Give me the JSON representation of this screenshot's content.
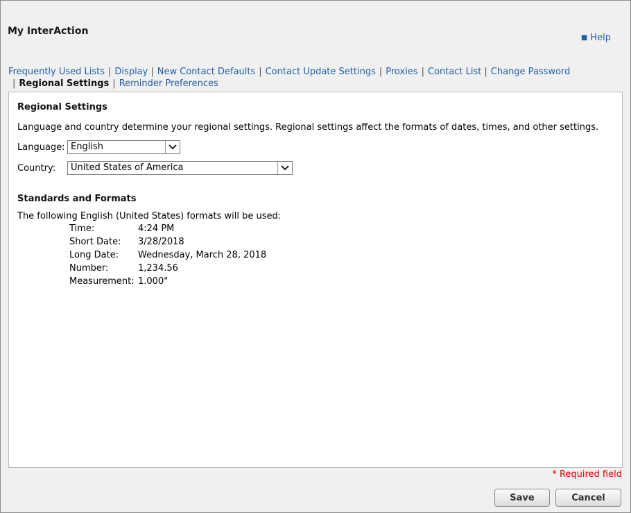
{
  "header": {
    "title": "My InterAction",
    "help_label": "Help"
  },
  "nav": {
    "items": [
      {
        "label": "Frequently Used Lists"
      },
      {
        "label": "Display"
      },
      {
        "label": "New Contact Defaults"
      },
      {
        "label": "Contact Update Settings"
      },
      {
        "label": "Proxies"
      },
      {
        "label": "Contact List"
      },
      {
        "label": "Change Password"
      },
      {
        "label": "Regional Settings",
        "active": true
      },
      {
        "label": "Reminder Preferences"
      }
    ],
    "separator": "|"
  },
  "regional": {
    "title": "Regional Settings",
    "description": "Language and country determine your regional settings. Regional settings affect the formats of dates, times, and other settings.",
    "language_label": "Language:",
    "language_value": "English",
    "country_label": "Country:",
    "country_value": "United States of America"
  },
  "formats": {
    "title": "Standards and Formats",
    "intro": "The following English (United States) formats will be used:",
    "rows": [
      {
        "label": "Time:",
        "value": "4:24 PM"
      },
      {
        "label": "Short Date:",
        "value": "3/28/2018"
      },
      {
        "label": "Long Date:",
        "value": "Wednesday, March 28, 2018"
      },
      {
        "label": "Number:",
        "value": "1,234.56"
      },
      {
        "label": "Measurement:",
        "value": "1.000\""
      }
    ]
  },
  "footer": {
    "required_note": "* Required field",
    "save_label": "Save",
    "cancel_label": "Cancel"
  },
  "icons": {
    "help_bullet": "square-bullet-icon",
    "dropdown": "chevron-down-icon"
  }
}
